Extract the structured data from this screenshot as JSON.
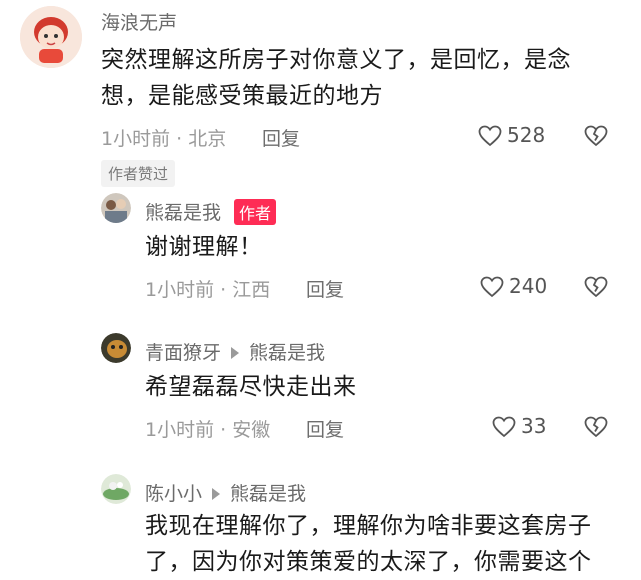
{
  "comments": [
    {
      "username": "海浪无声",
      "content_lines": [
        "突然理解这所房子对你意义了，是回忆，是念",
        "想，是能感受策最近的地方"
      ],
      "time_location": "1小时前 · 北京",
      "reply_label": "回复",
      "likes": "528",
      "badge": "作者赞过"
    },
    {
      "username": "熊磊是我",
      "author_tag": "作者",
      "content": "谢谢理解！",
      "time_location": "1小时前 · 江西",
      "reply_label": "回复",
      "likes": "240"
    },
    {
      "username": "青面獠牙",
      "reply_to": "熊磊是我",
      "content": "希望磊磊尽快走出来",
      "time_location": "1小时前 · 安徽",
      "reply_label": "回复",
      "likes": "33"
    },
    {
      "username": "陈小小",
      "reply_to": "熊磊是我",
      "content_lines": [
        "我现在理解你了，理解你为啥非要这套房子",
        "了，因为你对策策爱的太深了，你需要这个"
      ]
    }
  ],
  "icons": {
    "like": "heart-outline-icon",
    "dislike": "broken-heart-icon"
  },
  "colors": {
    "author_tag": "#fe2c55",
    "meta_text": "#9a9a9a"
  }
}
